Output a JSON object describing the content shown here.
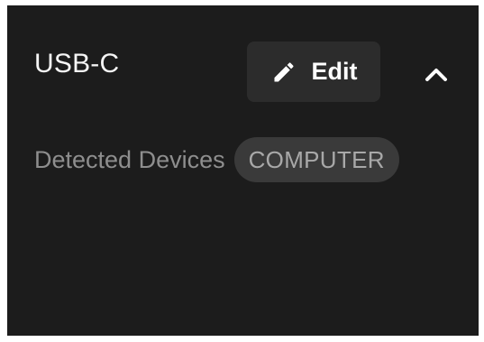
{
  "section": {
    "title": "USB-C",
    "edit_label": "Edit",
    "detected_label": "Detected Devices",
    "devices": [
      "COMPUTER"
    ]
  },
  "icons": {
    "edit": "pencil-icon",
    "collapse": "chevron-up-icon"
  },
  "colors": {
    "panel_bg": "#1c1c1c",
    "button_bg": "#2c2c2c",
    "chip_bg": "#3a3a3a",
    "text_primary": "#f5f5f5",
    "text_muted": "#8e8e8e"
  }
}
